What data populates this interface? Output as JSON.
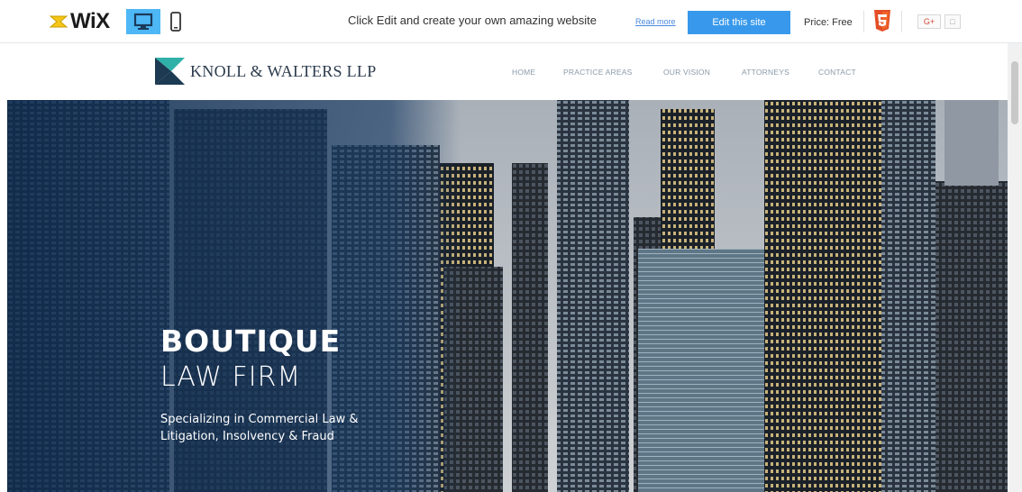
{
  "toolbar": {
    "logo_text": "WiX",
    "device_desktop": "desktop-icon",
    "device_mobile": "mobile-icon",
    "promo_text": "Click Edit and create your own amazing website",
    "read_more": "Read more",
    "edit_button": "Edit this site",
    "price": "Price: Free",
    "gplus": "G+",
    "accent": "#3899ec"
  },
  "site": {
    "brand_name": "KNOLL & WALTERS LLP",
    "nav": [
      "HOME",
      "PRACTICE AREAS",
      "OUR VISION",
      "ATTORNEYS",
      "CONTACT"
    ],
    "hero": {
      "title_line1": "BOUTIQUE",
      "title_line2": "LAW FIRM",
      "subtitle": "Specializing in Commercial Law & Litigation, Insolvency & Fraud"
    }
  }
}
